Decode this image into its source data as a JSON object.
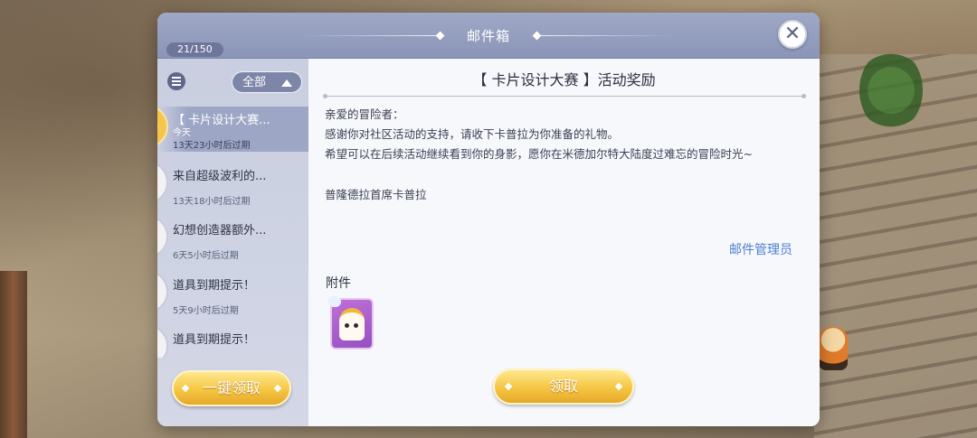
{
  "header": {
    "title": "邮件箱",
    "counter": "21/150",
    "close_symbol": "✕"
  },
  "sidebar": {
    "filter_label": "全部",
    "items": [
      {
        "title": "【 卡片设计大赛...",
        "date": "今天",
        "expire": "13天23小时后过期",
        "icon": "gift-icon",
        "selected": true
      },
      {
        "title": "来自超级波利的...",
        "date": "",
        "expire": "13天18小时后过期",
        "icon": "claimed-mail-icon",
        "selected": false
      },
      {
        "title": "幻想创造器额外...",
        "date": "",
        "expire": "6天5小时后过期",
        "icon": "claimed-mail-icon",
        "selected": false
      },
      {
        "title": "道具到期提示！",
        "date": "",
        "expire": "5天9小时后过期",
        "icon": "claimed-mail-icon",
        "selected": false
      },
      {
        "title": "道具到期提示！",
        "date": "",
        "expire": "",
        "icon": "claimed-mail-icon",
        "selected": false
      }
    ],
    "claim_all_label": "一键领取"
  },
  "mail": {
    "heading": "【 卡片设计大赛 】活动奖励",
    "lines": [
      "亲爱的冒险者：",
      "感谢你对社区活动的支持，请收下卡普拉为你准备的礼物。",
      "希望可以在后续活动继续看到你的身影，愿你在米德加尔特大陆度过难忘的冒险时光~"
    ],
    "signature": "普隆德拉首席卡普拉",
    "sender": "邮件管理员",
    "attachment_label": "附件",
    "attachment_icon": "poring-card-icon",
    "claim_label": "领取"
  },
  "colors": {
    "titlebar": "#8b95b7",
    "sidebar": "#c9cee0",
    "selected_item": "#9ea6c6",
    "button_gold": "#f5c642",
    "sender_link": "#4e7fd1"
  }
}
